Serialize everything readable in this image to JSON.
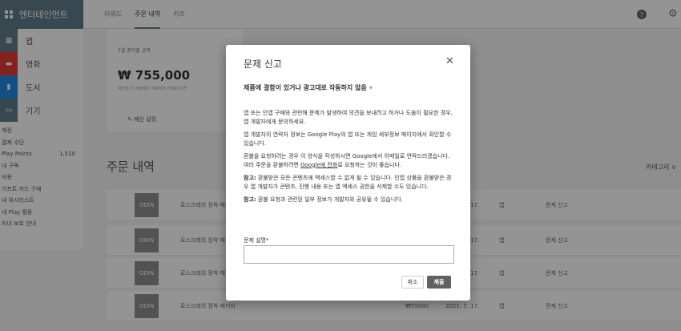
{
  "topbar": {
    "brand": "엔터테인먼트",
    "tabs": [
      "리워드",
      "주문 내역",
      "키즈"
    ],
    "help_icon": "help-icon",
    "settings_icon": "gear-icon"
  },
  "sidebar": {
    "categories": [
      {
        "label": "앱",
        "color": "#607d8b"
      },
      {
        "label": "영화",
        "color": "#e53935"
      },
      {
        "label": "도서",
        "color": "#1e88e5"
      },
      {
        "label": "기기",
        "color": "#607d8b"
      }
    ],
    "links": [
      {
        "label": "계정",
        "value": ""
      },
      {
        "label": "결제 수단",
        "value": ""
      },
      {
        "label": "Play Points",
        "value": "1,510"
      },
      {
        "label": "내 구독",
        "value": ""
      },
      {
        "label": "사용",
        "value": ""
      },
      {
        "label": "기프트 카드 구매",
        "value": ""
      },
      {
        "label": "내 위시리스트",
        "value": ""
      },
      {
        "label": "내 Play 활동",
        "value": ""
      },
      {
        "label": "자녀 보호 안내",
        "value": ""
      }
    ]
  },
  "summary": {
    "label": "7월 총지출 금액",
    "amount": "₩ 755,000",
    "note": "예산은 이 계정에만 적용되며 언제든지 변",
    "edit": "예산 설정"
  },
  "orders": {
    "title": "주문 내역",
    "category": "카테고리 ∨",
    "rows": [
      {
        "thumb": "ODIN",
        "title": "로스크레의 정착 패키지",
        "price": "",
        "date": "2021. 7. 17.",
        "type": "앱",
        "report": "문제 신고"
      },
      {
        "thumb": "ODIN",
        "title": "로스크레의 정착 패키지",
        "price": "",
        "date": "2021. 7. 17.",
        "type": "앱",
        "report": "문제 신고"
      },
      {
        "thumb": "ODIN",
        "title": "로스크레의 정착 패키지",
        "price": "",
        "date": "2021. 7. 17.",
        "type": "앱",
        "report": "문제 신고"
      },
      {
        "thumb": "ODIN",
        "title": "로스크레의 정착 패키지",
        "price": "₩55000",
        "date": "2021. 7. 17.",
        "type": "앱",
        "report": "문제 신고"
      }
    ]
  },
  "dialog": {
    "title": "문제 신고",
    "close_icon": "close-icon",
    "reason": "제품에 결함이 있거나 광고대로 작동하지 않음",
    "p1": "앱 또는 인앱 구매와 관련해 문제가 발생하여 의견을 보내려고 하거나 도움이 필요한 경우, 앱 개발자에게 문의하세요.",
    "p2": "앱 개발자의 연락처 정보는 Google Play의 앱 또는 게임 세부정보 페이지에서 확인할 수 있습니다.",
    "p3a": "환불을 요청하려는 경우 이 양식을 작성하시면 Google에서 이메일로 연락드리겠습니다. 여러 주문을 환불하려면 ",
    "p3link": "Google에 전화",
    "p3b": "로 요청하는 것이 좋습니다.",
    "note1_label": "참고:",
    "note1": " 환불받은 모든 콘텐츠에 액세스할 수 없게 될 수 있습니다. 인앱 상품을 환불받은 경우 앱 개발자가 콘텐츠, 진행 내용 또는 앱 액세스 권한을 삭제할 수도 있습니다.",
    "note2_label": "참고:",
    "note2": " 환불 요청과 관련된 일부 정보가 개발자와 공유될 수 있습니다.",
    "desc_label": "문제 설명*",
    "desc_value": "",
    "cancel": "취소",
    "submit": "제출"
  }
}
